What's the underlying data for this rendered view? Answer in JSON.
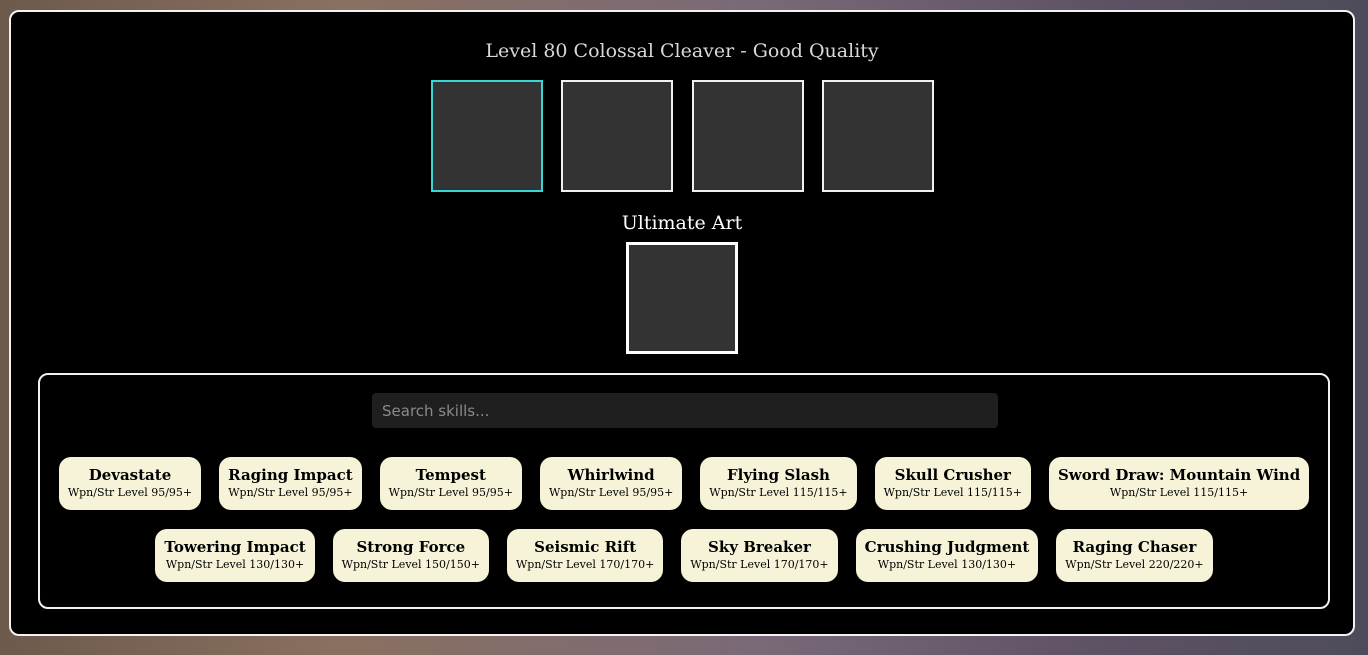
{
  "header": {
    "title": "Level 80 Colossal Cleaver - Good Quality"
  },
  "slots": [
    {
      "state": "active"
    },
    {
      "state": "empty"
    },
    {
      "state": "empty"
    },
    {
      "state": "empty"
    }
  ],
  "ultimate": {
    "label": "Ultimate Art"
  },
  "search": {
    "placeholder": "Search skills..."
  },
  "skills": [
    {
      "name": "Devastate",
      "requirement": "Wpn/Str Level 95/95+"
    },
    {
      "name": "Raging Impact",
      "requirement": "Wpn/Str Level 95/95+"
    },
    {
      "name": "Tempest",
      "requirement": "Wpn/Str Level 95/95+"
    },
    {
      "name": "Whirlwind",
      "requirement": "Wpn/Str Level 95/95+"
    },
    {
      "name": "Flying Slash",
      "requirement": "Wpn/Str Level 115/115+"
    },
    {
      "name": "Skull Crusher",
      "requirement": "Wpn/Str Level 115/115+"
    },
    {
      "name": "Sword Draw: Mountain Wind",
      "requirement": "Wpn/Str Level 115/115+"
    },
    {
      "name": "Towering Impact",
      "requirement": "Wpn/Str Level 130/130+"
    },
    {
      "name": "Strong Force",
      "requirement": "Wpn/Str Level 150/150+"
    },
    {
      "name": "Seismic Rift",
      "requirement": "Wpn/Str Level 170/170+"
    },
    {
      "name": "Sky Breaker",
      "requirement": "Wpn/Str Level 170/170+"
    },
    {
      "name": "Crushing Judgment",
      "requirement": "Wpn/Str Level 130/130+"
    },
    {
      "name": "Raging Chaser",
      "requirement": "Wpn/Str Level 220/220+"
    }
  ],
  "colors": {
    "active_slot_border": "#34d6d6",
    "skill_chip_bg": "#f6f3d9",
    "panel_bg": "#000000"
  }
}
